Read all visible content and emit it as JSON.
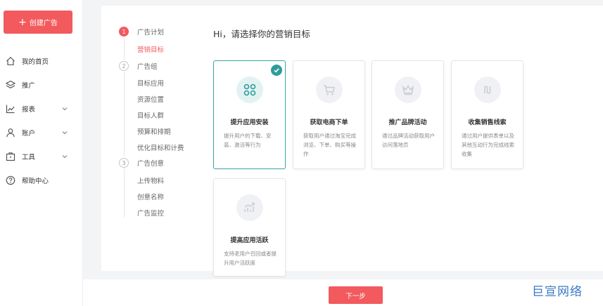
{
  "sidebar": {
    "create_label": "创建广告",
    "items": [
      {
        "label": "我的首页",
        "icon": "home-icon"
      },
      {
        "label": "推广",
        "icon": "layers-icon"
      },
      {
        "label": "报表",
        "icon": "chart-icon"
      },
      {
        "label": "账户",
        "icon": "user-icon"
      },
      {
        "label": "工具",
        "icon": "toolbox-icon"
      },
      {
        "label": "帮助中心",
        "icon": "help-icon"
      }
    ]
  },
  "steps": [
    {
      "num": "1",
      "label": "广告计划",
      "subs": [
        "营销目标"
      ]
    },
    {
      "num": "2",
      "label": "广告组",
      "subs": [
        "目标应用",
        "资源位置",
        "目标人群",
        "预算和排期",
        "优化目标和计费"
      ]
    },
    {
      "num": "3",
      "label": "广告创意",
      "subs": [
        "上传物料",
        "创意名称",
        "广告监控"
      ]
    }
  ],
  "page_title": "Hi，请选择你的营销目标",
  "cards": [
    {
      "title": "提升应用安装",
      "desc": "提升用户的下载、安装、激活等行为",
      "icon": "app-grid-icon"
    },
    {
      "title": "获取电商下单",
      "desc": "获取用户通过淘宝完成浏览、下单、购买等操作",
      "icon": "cart-icon"
    },
    {
      "title": "推广品牌活动",
      "desc": "通过品牌活动获取用户访问落地页",
      "icon": "crown-icon"
    },
    {
      "title": "收集销售线索",
      "desc": "通过用户提供表单以及其他互动行为完成线索收集",
      "icon": "route-icon"
    },
    {
      "title": "提高应用活跃",
      "desc": "支持老用户召回或者提升用户活跃度",
      "icon": "trend-icon"
    }
  ],
  "next_label": "下一步",
  "watermark": "巨宣网络",
  "colors": {
    "accent": "#f25a5e",
    "selected": "#2f9c9c",
    "brand_watermark": "#3b78c4"
  }
}
